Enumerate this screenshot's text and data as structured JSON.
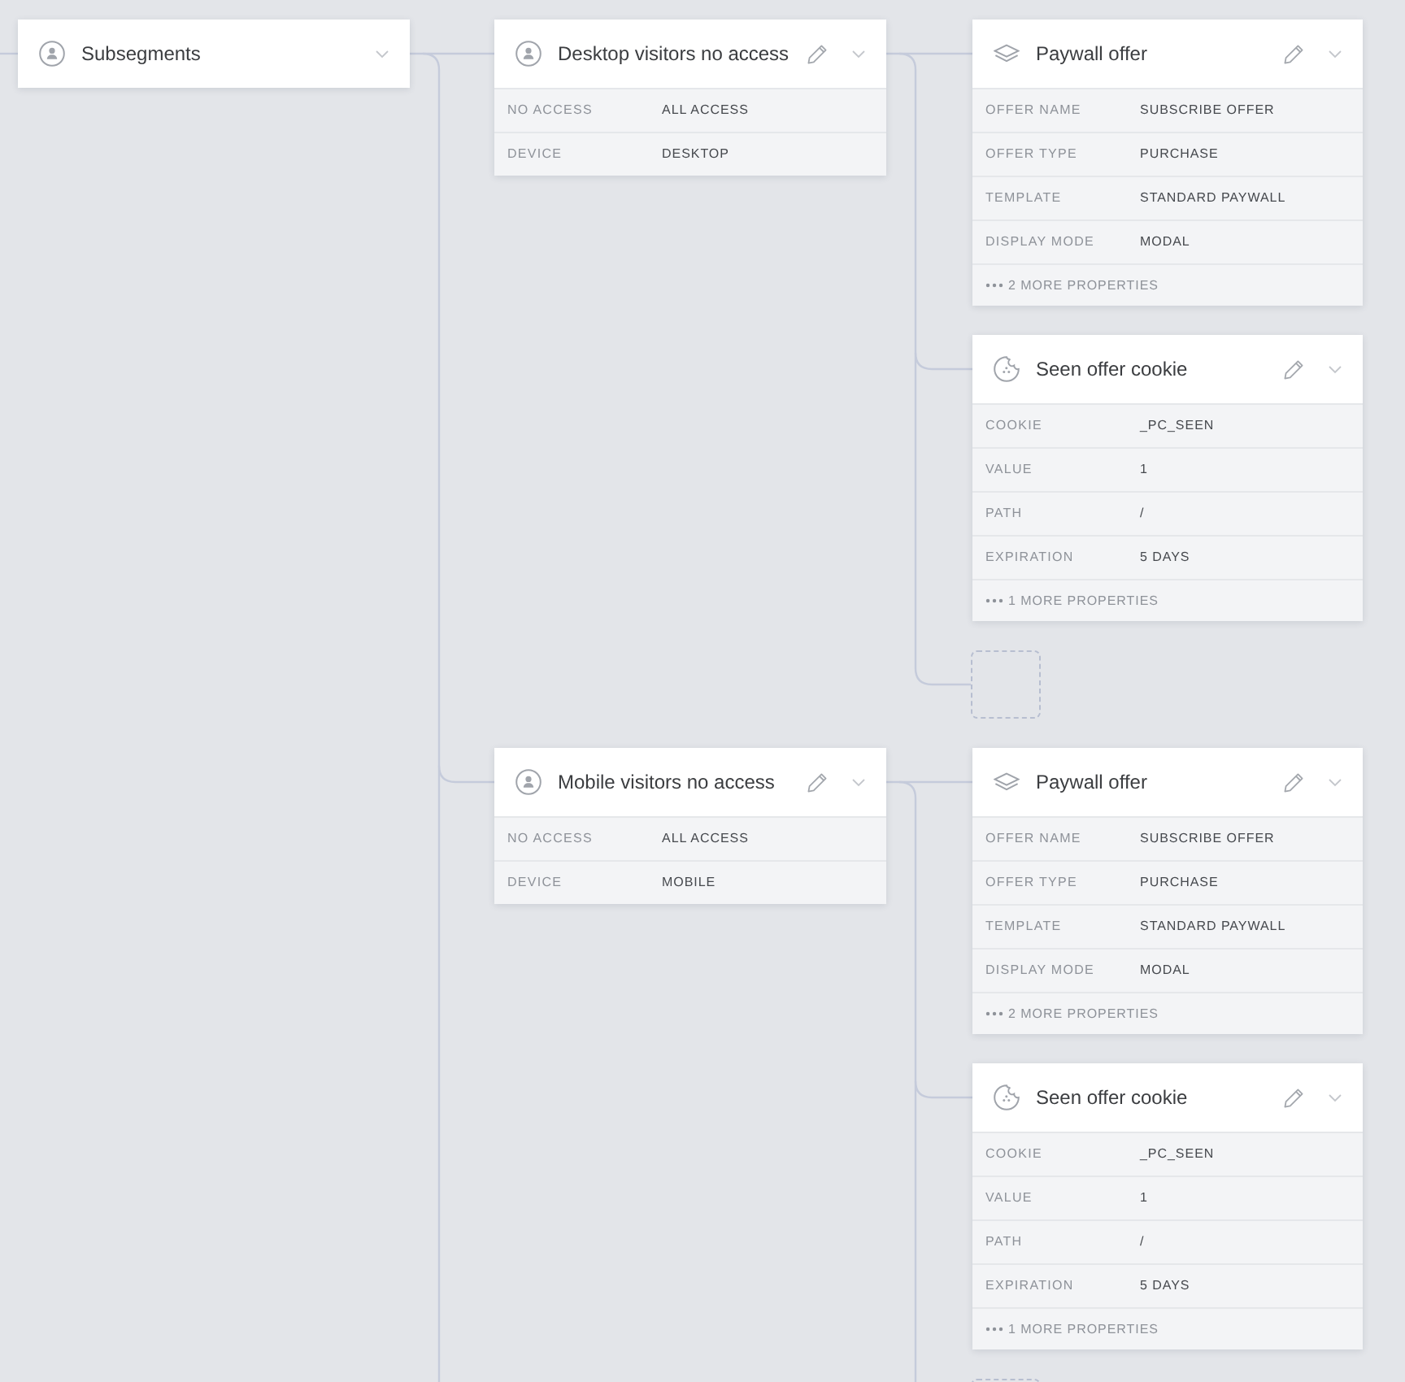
{
  "root_node": {
    "kind": "segment",
    "title": "Subsegments",
    "editable": false
  },
  "segments": [
    {
      "kind": "segment",
      "title": "Desktop visitors no access",
      "editable": true,
      "properties": [
        {
          "label": "NO ACCESS",
          "value": "ALL ACCESS"
        },
        {
          "label": "DEVICE",
          "value": "DESKTOP"
        }
      ],
      "actions": [
        {
          "kind": "offer",
          "title": "Paywall offer",
          "editable": true,
          "properties": [
            {
              "label": "OFFER NAME",
              "value": "SUBSCRIBE OFFER"
            },
            {
              "label": "OFFER TYPE",
              "value": "PURCHASE"
            },
            {
              "label": "TEMPLATE",
              "value": "STANDARD PAYWALL"
            },
            {
              "label": "DISPLAY MODE",
              "value": "MODAL"
            }
          ],
          "more": "2 MORE PROPERTIES"
        },
        {
          "kind": "cookie",
          "title": "Seen offer cookie",
          "editable": true,
          "properties": [
            {
              "label": "COOKIE",
              "value": "_PC_SEEN"
            },
            {
              "label": "VALUE",
              "value": "1"
            },
            {
              "label": "PATH",
              "value": "/"
            },
            {
              "label": "EXPIRATION",
              "value": "5 DAYS"
            }
          ],
          "more": "1 MORE PROPERTIES"
        }
      ],
      "empty_slot": true
    },
    {
      "kind": "segment",
      "title": "Mobile visitors no access",
      "editable": true,
      "properties": [
        {
          "label": "NO ACCESS",
          "value": "ALL ACCESS"
        },
        {
          "label": "DEVICE",
          "value": "MOBILE"
        }
      ],
      "actions": [
        {
          "kind": "offer",
          "title": "Paywall offer",
          "editable": true,
          "properties": [
            {
              "label": "OFFER NAME",
              "value": "SUBSCRIBE OFFER"
            },
            {
              "label": "OFFER TYPE",
              "value": "PURCHASE"
            },
            {
              "label": "TEMPLATE",
              "value": "STANDARD PAYWALL"
            },
            {
              "label": "DISPLAY MODE",
              "value": "MODAL"
            }
          ],
          "more": "2 MORE PROPERTIES"
        },
        {
          "kind": "cookie",
          "title": "Seen offer cookie",
          "editable": true,
          "properties": [
            {
              "label": "COOKIE",
              "value": "_PC_SEEN"
            },
            {
              "label": "VALUE",
              "value": "1"
            },
            {
              "label": "PATH",
              "value": "/"
            },
            {
              "label": "EXPIRATION",
              "value": "5 DAYS"
            }
          ],
          "more": "1 MORE PROPERTIES"
        }
      ],
      "empty_slot": true
    }
  ]
}
